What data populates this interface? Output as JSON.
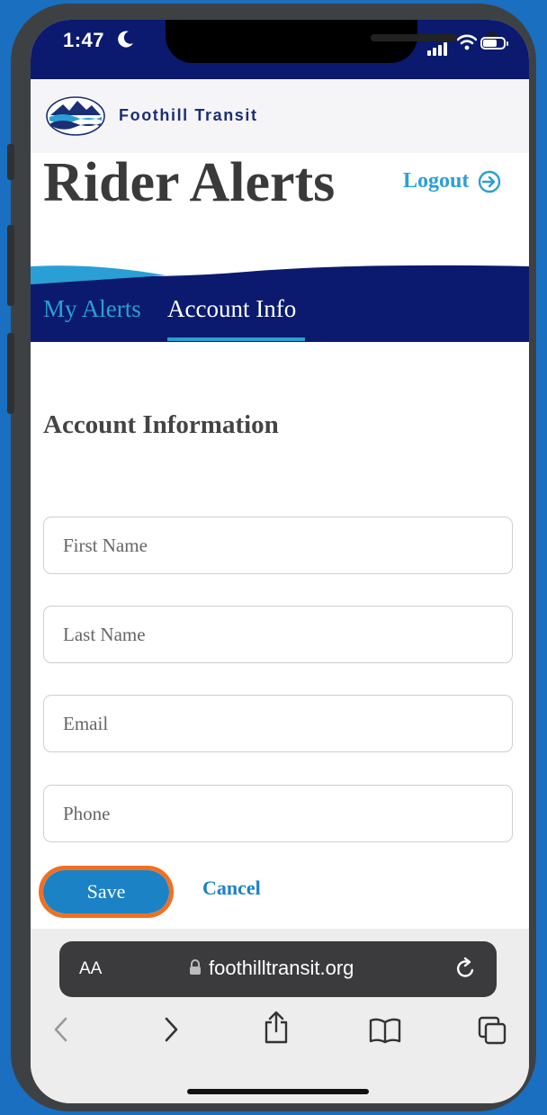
{
  "status_bar": {
    "time": "1:47"
  },
  "brand": {
    "name": "Foothill Transit"
  },
  "header": {
    "title": "Rider Alerts",
    "logout_label": "Logout"
  },
  "tabs": [
    {
      "label": "My Alerts",
      "active": false
    },
    {
      "label": "Account Info",
      "active": true
    }
  ],
  "form": {
    "section_title": "Account Information",
    "fields": [
      {
        "placeholder": "First Name",
        "value": ""
      },
      {
        "placeholder": "Last Name",
        "value": ""
      },
      {
        "placeholder": "Email",
        "value": ""
      },
      {
        "placeholder": "Phone",
        "value": ""
      }
    ],
    "save_label": "Save",
    "cancel_label": "Cancel"
  },
  "browser": {
    "text_size_label": "AA",
    "url": "foothilltransit.org"
  },
  "colors": {
    "nav_blue": "#0b1a6e",
    "accent_blue": "#2a9fd6",
    "button_blue": "#1b82c6",
    "highlight_orange": "#f07022",
    "page_background": "#1a6fc0"
  },
  "icons": [
    "moon-icon",
    "signal-icon",
    "wifi-icon",
    "battery-icon",
    "foothill-logo",
    "logout-arrow-icon",
    "lock-icon",
    "reload-icon",
    "back-icon",
    "forward-icon",
    "share-icon",
    "bookmarks-icon",
    "tabs-icon"
  ]
}
